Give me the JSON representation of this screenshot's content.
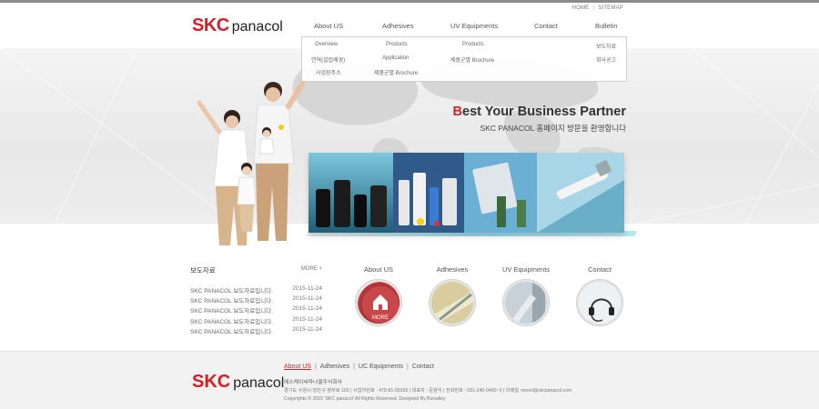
{
  "utility": {
    "home": "HOME",
    "sitemap": "SITEMAP"
  },
  "logo": {
    "brand": "SKC",
    "name": "panacol"
  },
  "nav": [
    "About US",
    "Adhesives",
    "UV Equipments",
    "Contact",
    "Bulletin"
  ],
  "dropdown": {
    "about": [
      "Overview",
      "연혁(설립배경)",
      "사업장주소"
    ],
    "adhesives": [
      "Products",
      "Application",
      "제품군별 Brochure"
    ],
    "uv": [
      "Products",
      "제품군별 Brochure"
    ],
    "bulletin": [
      "보도자료",
      "회사공고"
    ]
  },
  "hero": {
    "headline_first": "B",
    "headline_rest": "est Your Business Partner",
    "subline": "SKC PANACOL 홈페이지 방문을 환영합니다"
  },
  "news": {
    "title": "보도자료",
    "more": "MORE",
    "items": [
      {
        "title": "SKC PANACOL 보도자료입니다.",
        "date": "2015-11-24"
      },
      {
        "title": "SKC PANACOL 보도자료입니다.",
        "date": "2015-11-24"
      },
      {
        "title": "SKC PANACOL 보도자료입니다.",
        "date": "2015-11-24"
      },
      {
        "title": "SKC PANACOL 보도자료입니다.",
        "date": "2015-11-24"
      },
      {
        "title": "SKC PANACOL 보도자료입니다.",
        "date": "2015-11-24"
      }
    ]
  },
  "quick": [
    {
      "label": "About US",
      "badge": "MORE"
    },
    {
      "label": "Adhesives"
    },
    {
      "label": "UV Equipments"
    },
    {
      "label": "Contact"
    }
  ],
  "footer": {
    "nav": [
      "About US",
      "Adhesives",
      "UC Equipments",
      "Contact"
    ],
    "company": "에스케이씨파나콜주식회사",
    "address": "경기도 수원시 장안구 정자로 102 | 사업자번호 : 479-81-00165 | 대표자 : 문광익 | 전화번호 : 031-240-0490~3 | 이메일 :moon@skcpanacol.com",
    "copyright": "Copyrights © 2015 'SKC panacol' All Rights Reserved. Designed By Bizvalley"
  },
  "colors": {
    "brand_red": "#d2202a",
    "accent_cyan": "#3ab8d0"
  }
}
